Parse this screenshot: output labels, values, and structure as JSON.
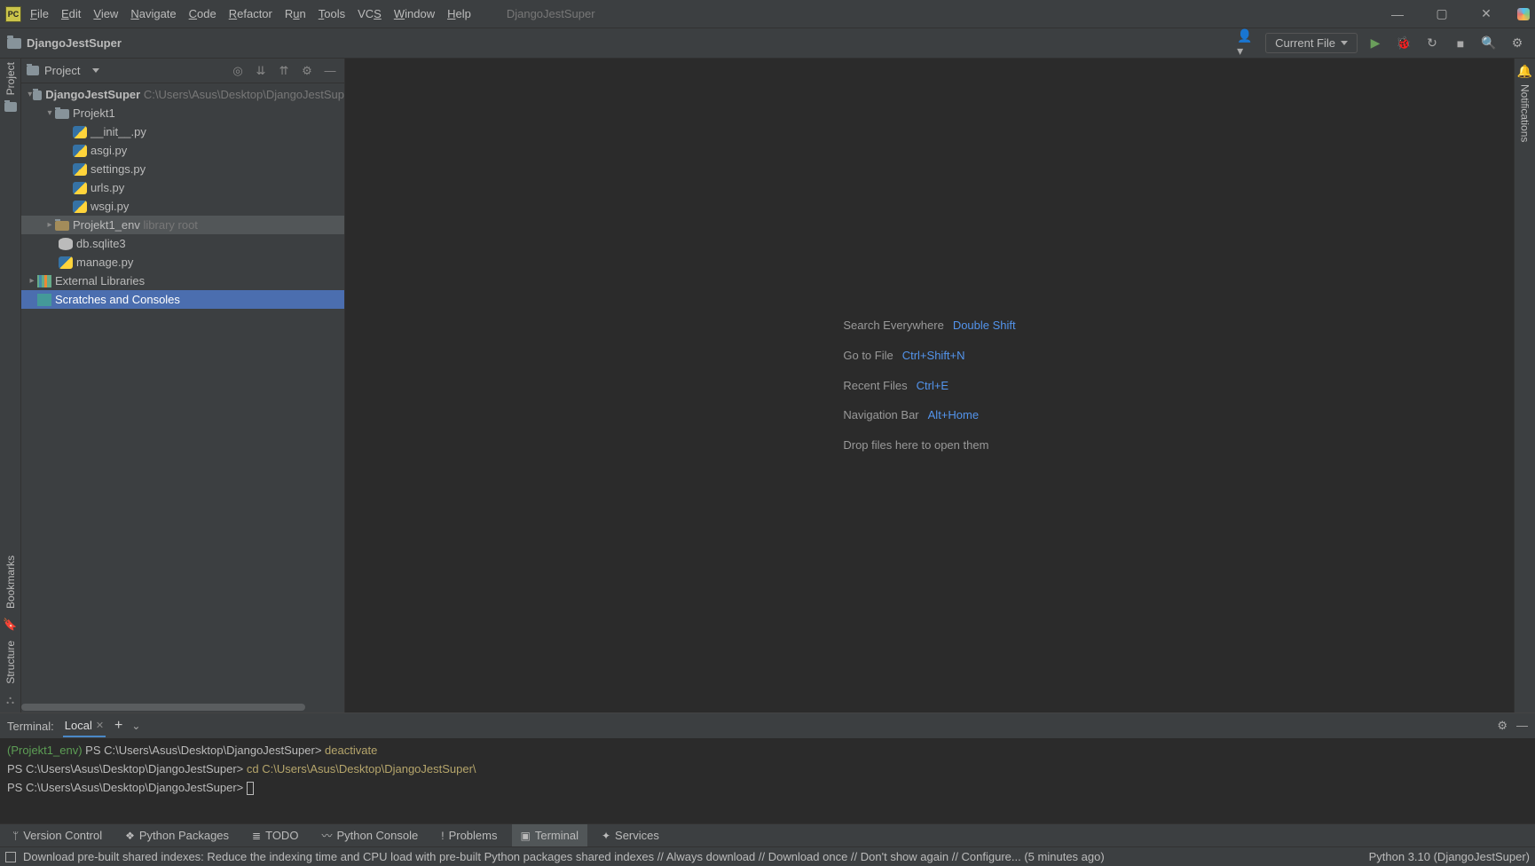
{
  "menu": {
    "file": "File",
    "edit": "Edit",
    "view": "View",
    "navigate": "Navigate",
    "code": "Code",
    "refactor": "Refactor",
    "run": "Run",
    "tools": "Tools",
    "vcs": "VCS",
    "window": "Window",
    "help": "Help"
  },
  "app_title": "DjangoJestSuper",
  "breadcrumb": "DjangoJestSuper",
  "current_file_btn": "Current File",
  "project_panel": {
    "title": "Project"
  },
  "tree": {
    "root": {
      "name": "DjangoJestSuper",
      "path": "C:\\Users\\Asus\\Desktop\\DjangoJestSup"
    },
    "projekt1": "Projekt1",
    "files": [
      "__init__.py",
      "asgi.py",
      "settings.py",
      "urls.py",
      "wsgi.py"
    ],
    "env": {
      "name": "Projekt1_env",
      "hint": "library root"
    },
    "db": "db.sqlite3",
    "manage": "manage.py",
    "ext": "External Libraries",
    "scratch": "Scratches and Consoles"
  },
  "shortcuts": {
    "search": {
      "label": "Search Everywhere",
      "key": "Double Shift"
    },
    "goto": {
      "label": "Go to File",
      "key": "Ctrl+Shift+N"
    },
    "recent": {
      "label": "Recent Files",
      "key": "Ctrl+E"
    },
    "nav": {
      "label": "Navigation Bar",
      "key": "Alt+Home"
    },
    "drop": "Drop files here to open them"
  },
  "terminal": {
    "label": "Terminal:",
    "tab": "Local",
    "lines": {
      "l1env": "(Projekt1_env)",
      "l1ps": " PS C:\\Users\\Asus\\Desktop\\DjangoJestSuper> ",
      "l1cmd": "deactivate",
      "l2ps": "PS C:\\Users\\Asus\\Desktop\\DjangoJestSuper> ",
      "l2cmd": "cd C:\\Users\\Asus\\Desktop\\DjangoJestSuper\\",
      "l3ps": "PS C:\\Users\\Asus\\Desktop\\DjangoJestSuper> "
    }
  },
  "tooltabs": {
    "vc": "Version Control",
    "pp": "Python Packages",
    "todo": "TODO",
    "pc": "Python Console",
    "prob": "Problems",
    "term": "Terminal",
    "serv": "Services"
  },
  "status": {
    "msg": "Download pre-built shared indexes: Reduce the indexing time and CPU load with pre-built Python packages shared indexes // Always download // Download once // Don't show again // Configure... (5 minutes ago)",
    "right": "Python 3.10 (DjangoJestSuper)"
  },
  "gutters": {
    "project": "Project",
    "bookmarks": "Bookmarks",
    "structure": "Structure",
    "notifications": "Notifications"
  }
}
